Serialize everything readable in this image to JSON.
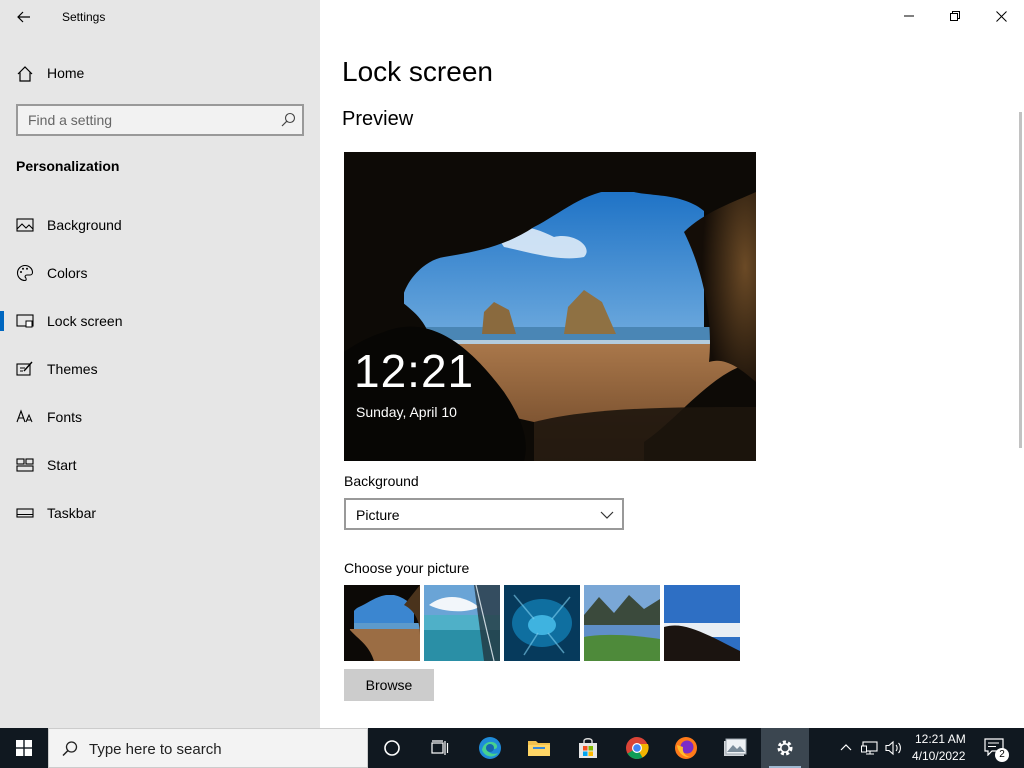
{
  "window": {
    "app_title": "Settings",
    "controls": [
      "minimize",
      "restore",
      "close"
    ]
  },
  "sidebar": {
    "home_label": "Home",
    "search_placeholder": "Find a setting",
    "section_label": "Personalization",
    "items": [
      {
        "label": "Background",
        "icon": "picture-icon",
        "active": false
      },
      {
        "label": "Colors",
        "icon": "palette-icon",
        "active": false
      },
      {
        "label": "Lock screen",
        "icon": "lock-screen-icon",
        "active": true
      },
      {
        "label": "Themes",
        "icon": "themes-icon",
        "active": false
      },
      {
        "label": "Fonts",
        "icon": "fonts-icon",
        "active": false
      },
      {
        "label": "Start",
        "icon": "start-icon",
        "active": false
      },
      {
        "label": "Taskbar",
        "icon": "taskbar-icon",
        "active": false
      }
    ]
  },
  "main": {
    "page_title": "Lock screen",
    "preview_heading": "Preview",
    "preview_time": "12:21",
    "preview_date": "Sunday, April 10",
    "background_label": "Background",
    "background_value": "Picture",
    "choose_label": "Choose your picture",
    "thumbnails": [
      "beach-cave",
      "glass-water",
      "underwater",
      "mountain-lake",
      "hilltop-clouds"
    ],
    "browse_label": "Browse"
  },
  "taskbar": {
    "search_placeholder": "Type here to search",
    "apps": [
      "cortana",
      "task-view",
      "edge",
      "file-explorer",
      "store",
      "chrome",
      "firefox",
      "photos",
      "settings"
    ],
    "clock_time": "12:21 AM",
    "clock_date": "4/10/2022",
    "notification_count": "2"
  },
  "colors": {
    "accent": "#0067c0",
    "sidebar_bg": "#e6e6e6",
    "taskbar_bg": "#101820"
  }
}
